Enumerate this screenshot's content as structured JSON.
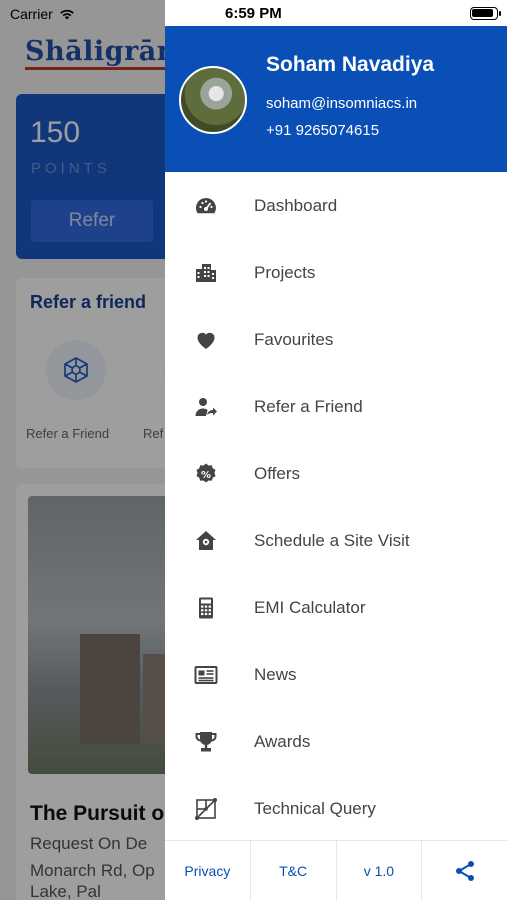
{
  "background": {
    "carrier": "Carrier",
    "logo": "Shāligrām",
    "points": {
      "value": "150",
      "label": "POINTS",
      "refer_button": "Refer"
    },
    "refer_section": {
      "title": "Refer a friend",
      "items": [
        "Refer a Friend",
        "Ref"
      ]
    },
    "project": {
      "title": "The Pursuit o",
      "subtitle": "Request On De",
      "address_line1": "Monarch Rd, Op",
      "address_line2": "Lake, Pal"
    }
  },
  "status_bar": {
    "time": "6:59 PM"
  },
  "profile": {
    "name": "Soham Navadiya",
    "email": "soham@insomniacs.in",
    "phone": "+91 9265074615"
  },
  "menu": [
    {
      "label": "Dashboard",
      "icon": "dashboard-icon"
    },
    {
      "label": "Projects",
      "icon": "buildings-icon"
    },
    {
      "label": "Favourites",
      "icon": "heart-icon"
    },
    {
      "label": "Refer a Friend",
      "icon": "refer-user-icon"
    },
    {
      "label": "Offers",
      "icon": "percent-badge-icon"
    },
    {
      "label": "Schedule a Site Visit",
      "icon": "home-pin-icon"
    },
    {
      "label": "EMI Calculator",
      "icon": "calculator-icon"
    },
    {
      "label": "News",
      "icon": "newspaper-icon"
    },
    {
      "label": "Awards",
      "icon": "trophy-icon"
    },
    {
      "label": "Technical Query",
      "icon": "technical-query-icon"
    }
  ],
  "footer": {
    "privacy": "Privacy",
    "terms": "T&C",
    "version": "v 1.0",
    "share_icon": "share-icon"
  },
  "colors": {
    "primary": "#0a4fb5",
    "menu_text": "#444444",
    "icon": "#444444"
  }
}
